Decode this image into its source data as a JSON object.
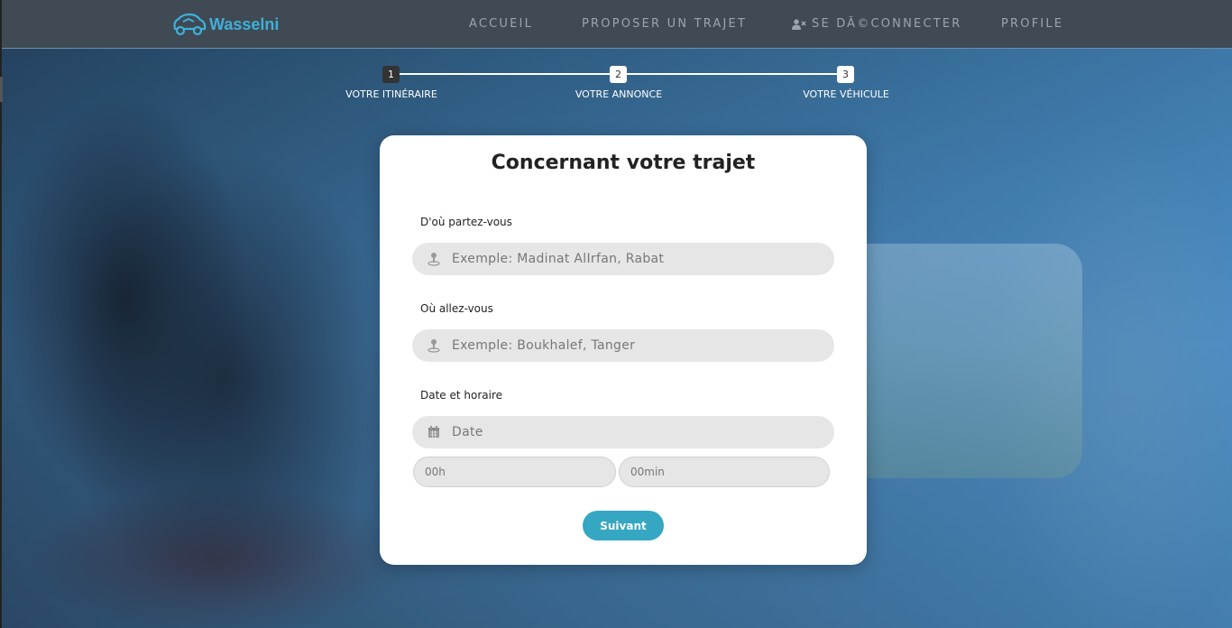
{
  "brand": {
    "name": "Wasselni",
    "color": "#3fb0d9"
  },
  "nav": [
    {
      "label": "ACCUEIL",
      "icon": ""
    },
    {
      "label": "PROPOSER UN TRAJET",
      "icon": ""
    },
    {
      "label": "SE DÃ©CONNECTER",
      "icon": "user-times-icon"
    },
    {
      "label": "PROFILE",
      "icon": ""
    }
  ],
  "stepper": {
    "steps": [
      {
        "number": "1",
        "label": "VOTRE ITINÉRAIRE",
        "active": true
      },
      {
        "number": "2",
        "label": "VOTRE ANNONCE",
        "active": false
      },
      {
        "number": "3",
        "label": "VOTRE VÉHICULE",
        "active": false
      }
    ]
  },
  "form": {
    "title": "Concernant votre trajet",
    "departure": {
      "label": "D'où partez-vous",
      "placeholder": "Exemple: Madinat AlIrfan, Rabat",
      "icon": "map-marker-icon"
    },
    "destination": {
      "label": "Où allez-vous",
      "placeholder": "Exemple: Boukhalef, Tanger",
      "icon": "map-marker-icon"
    },
    "datetime": {
      "label": "Date et horaire",
      "date_placeholder": "Date",
      "date_icon": "calendar-icon",
      "hour_placeholder": "00h",
      "minute_placeholder": "00min"
    },
    "submit_label": "Suivant",
    "accent_color": "#35a7c2"
  }
}
